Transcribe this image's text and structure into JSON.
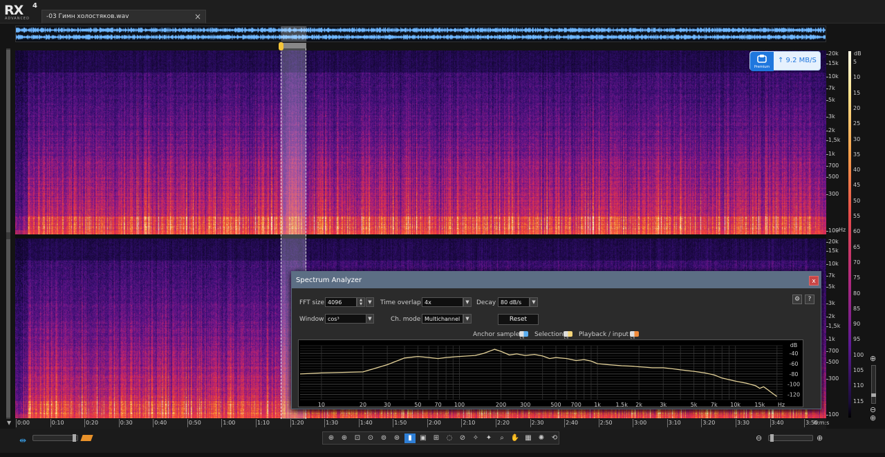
{
  "app": {
    "logo": "RX",
    "logo_version": "4",
    "logo_edition": "ADVANCED"
  },
  "document_tab": {
    "label": "-03 Гимн холостяков.wav",
    "close_glyph": "×"
  },
  "spectrogram": {
    "frequency_ticks_top": [
      {
        "label": "20k",
        "hz": 20000
      },
      {
        "label": "15k",
        "hz": 15000
      },
      {
        "label": "10k",
        "hz": 10000
      },
      {
        "label": "7k",
        "hz": 7000
      },
      {
        "label": "5k",
        "hz": 5000
      },
      {
        "label": "3k",
        "hz": 3000
      },
      {
        "label": "2k",
        "hz": 2000
      },
      {
        "label": "1,5k",
        "hz": 1500
      },
      {
        "label": "1k",
        "hz": 1000
      },
      {
        "label": "700",
        "hz": 700
      },
      {
        "label": "500",
        "hz": 500
      },
      {
        "label": "300",
        "hz": 300
      },
      {
        "label": "100",
        "hz": 100
      }
    ],
    "frequency_unit": "Hz",
    "frequency_ticks_bottom": [
      {
        "label": "20k",
        "hz": 20000
      },
      {
        "label": "15k",
        "hz": 15000
      },
      {
        "label": "10k",
        "hz": 10000
      },
      {
        "label": "7k",
        "hz": 7000
      },
      {
        "label": "5k",
        "hz": 5000
      },
      {
        "label": "3k",
        "hz": 3000
      },
      {
        "label": "2k",
        "hz": 2000
      },
      {
        "label": "1,5k",
        "hz": 1500
      },
      {
        "label": "1k",
        "hz": 1000
      },
      {
        "label": "700",
        "hz": 700
      },
      {
        "label": "500",
        "hz": 500
      },
      {
        "label": "300",
        "hz": 300
      },
      {
        "label": "100",
        "hz": 100
      }
    ],
    "db_unit": "dB",
    "db_ticks": [
      "5",
      "10",
      "15",
      "20",
      "25",
      "30",
      "35",
      "40",
      "45",
      "50",
      "55",
      "60",
      "65",
      "70",
      "75",
      "80",
      "85",
      "90",
      "95",
      "100",
      "105",
      "110",
      "115"
    ],
    "selection_start": "1:20",
    "selection_end": "1:26"
  },
  "timeline": {
    "ticks": [
      "0:00",
      "0:10",
      "0:20",
      "0:30",
      "0:40",
      "0:50",
      "1:00",
      "1:10",
      "1:20",
      "1:30",
      "1:40",
      "1:50",
      "2:00",
      "2:10",
      "2:20",
      "2:30",
      "2:40",
      "2:50",
      "3:00",
      "3:10",
      "3:20",
      "3:30",
      "3:40",
      "3:50"
    ],
    "unit": "h:m:s",
    "total_seconds": 232
  },
  "network_widget": {
    "badge": "Premium",
    "speed": "↑ 9.2 MB/S"
  },
  "analyzer": {
    "title": "Spectrum Analyzer",
    "close_glyph": "x",
    "fft_size_label": "FFT size",
    "fft_size_value": "4096",
    "time_overlap_label": "Time overlap",
    "time_overlap_value": "4x",
    "decay_label": "Decay",
    "decay_value": "80 dB/s",
    "window_label": "Window",
    "window_value": "cos³",
    "ch_mode_label": "Ch. mode",
    "ch_mode_value": "Multichannel",
    "reset_label": "Reset",
    "wrench_glyph": "⚙",
    "help_glyph": "?",
    "legend": [
      {
        "name": "Anchor sample",
        "color": "#5aaef0"
      },
      {
        "name": "Selection",
        "color": "#f4d57a"
      },
      {
        "name": "Playback / input",
        "color": "#f08a3a"
      }
    ],
    "chart_data": {
      "type": "line",
      "x_unit": "Hz",
      "y_unit": "dB",
      "x_scale": "log",
      "xlim": [
        7,
        22000
      ],
      "ylim": [
        -130,
        -25
      ],
      "x_ticks": [
        {
          "label": "10",
          "hz": 10
        },
        {
          "label": "20",
          "hz": 20
        },
        {
          "label": "30",
          "hz": 30
        },
        {
          "label": "50",
          "hz": 50
        },
        {
          "label": "70",
          "hz": 70
        },
        {
          "label": "100",
          "hz": 100
        },
        {
          "label": "200",
          "hz": 200
        },
        {
          "label": "300",
          "hz": 300
        },
        {
          "label": "500",
          "hz": 500
        },
        {
          "label": "700",
          "hz": 700
        },
        {
          "label": "1k",
          "hz": 1000
        },
        {
          "label": "1.5k",
          "hz": 1500
        },
        {
          "label": "2k",
          "hz": 2000
        },
        {
          "label": "3k",
          "hz": 3000
        },
        {
          "label": "5k",
          "hz": 5000
        },
        {
          "label": "7k",
          "hz": 7000
        },
        {
          "label": "10k",
          "hz": 10000
        },
        {
          "label": "15k",
          "hz": 15000
        }
      ],
      "y_ticks": [
        -40,
        -60,
        -80,
        -100,
        -120
      ],
      "series": [
        {
          "color": "#e6d49a",
          "x": [
            7,
            10,
            20,
            30,
            40,
            50,
            60,
            70,
            80,
            100,
            130,
            150,
            180,
            200,
            230,
            260,
            300,
            350,
            400,
            450,
            500,
            600,
            700,
            800,
            900,
            1000,
            1200,
            1500,
            1800,
            2000,
            2500,
            3000,
            3500,
            4000,
            5000,
            6000,
            7000,
            8000,
            10000,
            12000,
            14000,
            15000,
            16000,
            17000,
            18000,
            20000
          ],
          "y": [
            -80,
            -78,
            -76,
            -62,
            -49,
            -46,
            -48,
            -50,
            -48,
            -46,
            -44,
            -40,
            -32,
            -36,
            -43,
            -41,
            -44,
            -42,
            -45,
            -50,
            -48,
            -50,
            -54,
            -52,
            -55,
            -60,
            -62,
            -64,
            -65,
            -66,
            -68,
            -68,
            -70,
            -72,
            -75,
            -78,
            -82,
            -88,
            -94,
            -98,
            -103,
            -108,
            -105,
            -110,
            -115,
            -124
          ]
        }
      ]
    }
  },
  "toolbar_icons": [
    "zoom-time-icon",
    "zoom-freq-icon",
    "zoom-fit-icon",
    "zoom-reset-icon",
    "zoom-selection-icon",
    "zoom-full-icon",
    "time-select-icon",
    "time-freq-select-icon",
    "freq-select-icon",
    "lasso-icon",
    "brush-icon",
    "magic-wand-icon",
    "harmonic-wand-icon",
    "magnifier-icon",
    "hand-icon",
    "grid-icon",
    "spark-icon",
    "undo-icon"
  ]
}
